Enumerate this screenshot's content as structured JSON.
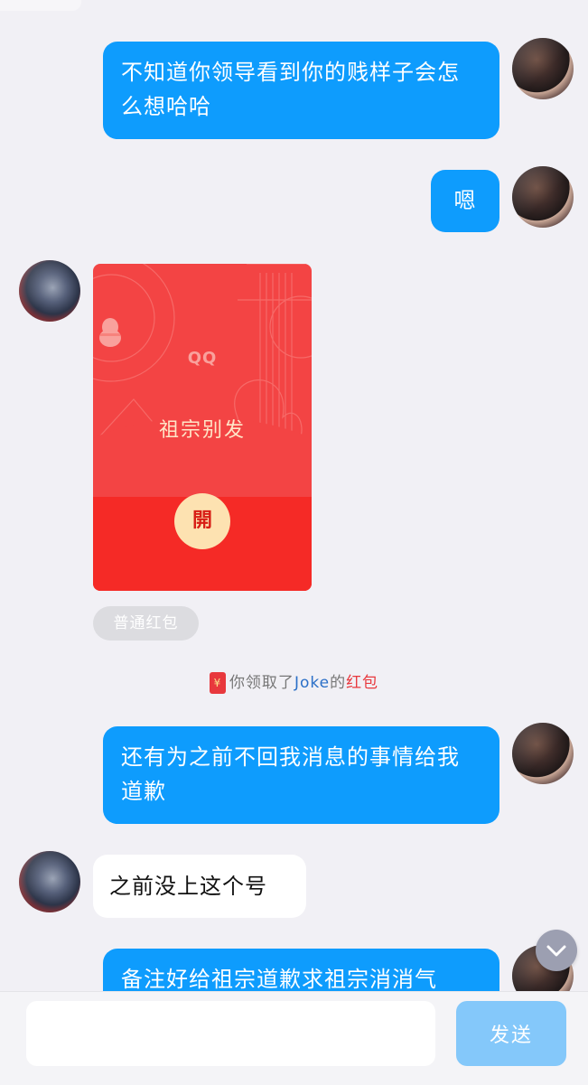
{
  "messages": [
    {
      "id": "m1",
      "sender": "self",
      "text": "不知道你领导看到你的贱样子会怎么想哈哈"
    },
    {
      "id": "m2",
      "sender": "self",
      "text": "嗯"
    },
    {
      "id": "m3",
      "sender": "other",
      "type": "red_packet"
    },
    {
      "id": "m4",
      "sender": "self",
      "text": "还有为之前不回我消息的事情给我道歉"
    },
    {
      "id": "m5",
      "sender": "other",
      "text": "之前没上这个号"
    },
    {
      "id": "m6",
      "sender": "self",
      "text": "备注好给祖宗道歉求祖宗消消气"
    }
  ],
  "red_packet": {
    "brand": "QQ",
    "title": "祖宗别发",
    "open_label": "開",
    "type_tag": "普通红包"
  },
  "system_notice": {
    "prefix": "你领取了",
    "name": "Joke",
    "connector": "的",
    "link": "红包",
    "icon": "¥"
  },
  "input": {
    "value": "",
    "send_label": "发送"
  },
  "icons": {
    "scroll_down": "chevron-down-icon"
  },
  "colors": {
    "self_bubble": "#0e9cfd",
    "other_bubble": "#ffffff",
    "red_packet": "#f34444",
    "send_button": "#84c8fa",
    "background": "#f1f0f5"
  }
}
